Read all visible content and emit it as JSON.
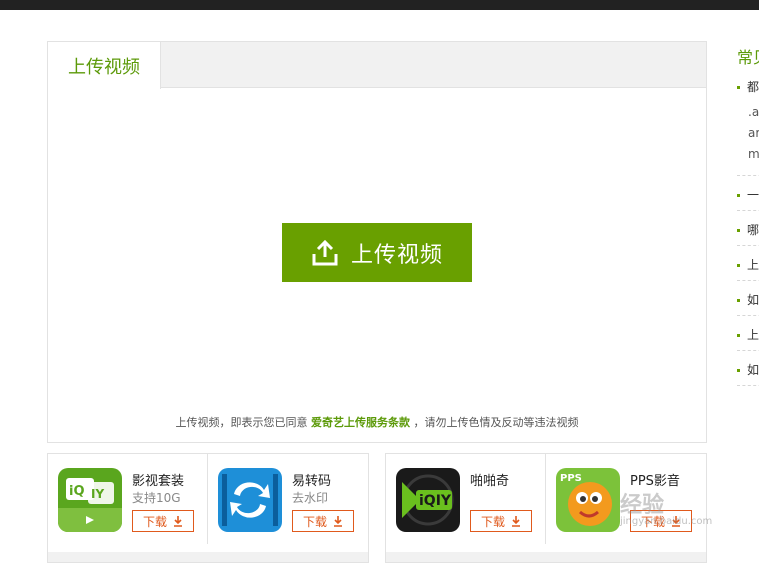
{
  "tab": {
    "label": "上传视频"
  },
  "upload_button": {
    "label": "上传视频"
  },
  "terms": {
    "prefix": "上传视频，即表示您已同意",
    "link": "爱奇艺上传服务条款",
    "suffix": "，请勿上传色情及反动等违法视频"
  },
  "sidebar": {
    "title": "常见",
    "items": [
      "都",
      "一",
      "哪",
      "上",
      "如",
      "上",
      "如"
    ],
    "sub_lines": [
      ".a",
      "ar",
      "m"
    ]
  },
  "apps": [
    {
      "name": "影视套装",
      "desc": "支持10G",
      "download": "下载",
      "icon": "iqiyi-tv-icon"
    },
    {
      "name": "易转码",
      "desc": "去水印",
      "download": "下载",
      "icon": "transcode-icon"
    },
    {
      "name": "啪啪奇",
      "desc": "",
      "download": "下载",
      "icon": "papaqi-icon"
    },
    {
      "name": "PPS影音",
      "desc": "",
      "download": "下载",
      "icon": "pps-icon"
    }
  ],
  "watermark": {
    "text": "经验",
    "sub": "jingyan.baidu.com"
  },
  "colors": {
    "accent": "#69a000",
    "download": "#e05a1d",
    "topbar": "#222222"
  }
}
